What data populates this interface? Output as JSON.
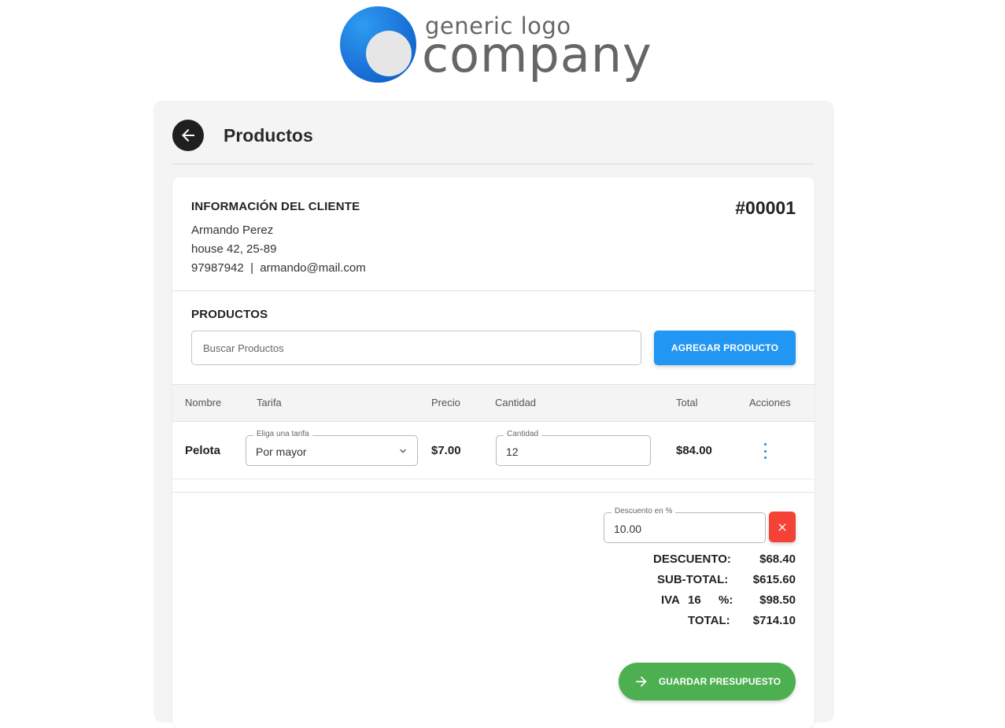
{
  "logo": {
    "small_text": "generic logo",
    "big_text": "company"
  },
  "header": {
    "title": "Productos"
  },
  "client": {
    "heading": "INFORMACIÓN DEL CLIENTE",
    "name": "Armando Perez",
    "address": "house 42, 25-89",
    "contact": "97987942  |  armando@mail.com",
    "quote_number": "#00001"
  },
  "products": {
    "heading": "PRODUCTOS",
    "search_placeholder": "Buscar Productos",
    "add_button": "AGREGAR PRODUCTO"
  },
  "table": {
    "headers": [
      "Nombre",
      "Tarifa",
      "Precio",
      "Cantidad",
      "Total",
      "Acciones"
    ],
    "rows": [
      {
        "name": "Pelota",
        "tariff_label": "Eliga una tarifa",
        "tariff": "Por mayor",
        "price": "$7.00",
        "quantity_label": "Cantidad",
        "quantity": "12",
        "total": "$84.00"
      }
    ]
  },
  "discount": {
    "label": "Descuento en %",
    "value": "10.00"
  },
  "summary": {
    "discount_label": "DESCUENTO:",
    "discount_value": "$68.40",
    "subtotal_label": "SUB-TOTAL:",
    "subtotal_value": "$615.60",
    "iva_label": "IVA",
    "iva_rate": "16",
    "iva_percent": "%:",
    "iva_value": "$98.50",
    "total_label": "TOTAL:",
    "total_value": "$714.10"
  },
  "save_button": "GUARDAR PRESUPUESTO",
  "colors": {
    "primary": "#2196f3",
    "danger": "#f44336",
    "success": "#4caf50",
    "dark": "#1f1f1f"
  },
  "icons": [
    "arrow-left-icon",
    "chevron-down-icon",
    "more-vert-icon",
    "close-icon",
    "arrow-right-icon"
  ]
}
